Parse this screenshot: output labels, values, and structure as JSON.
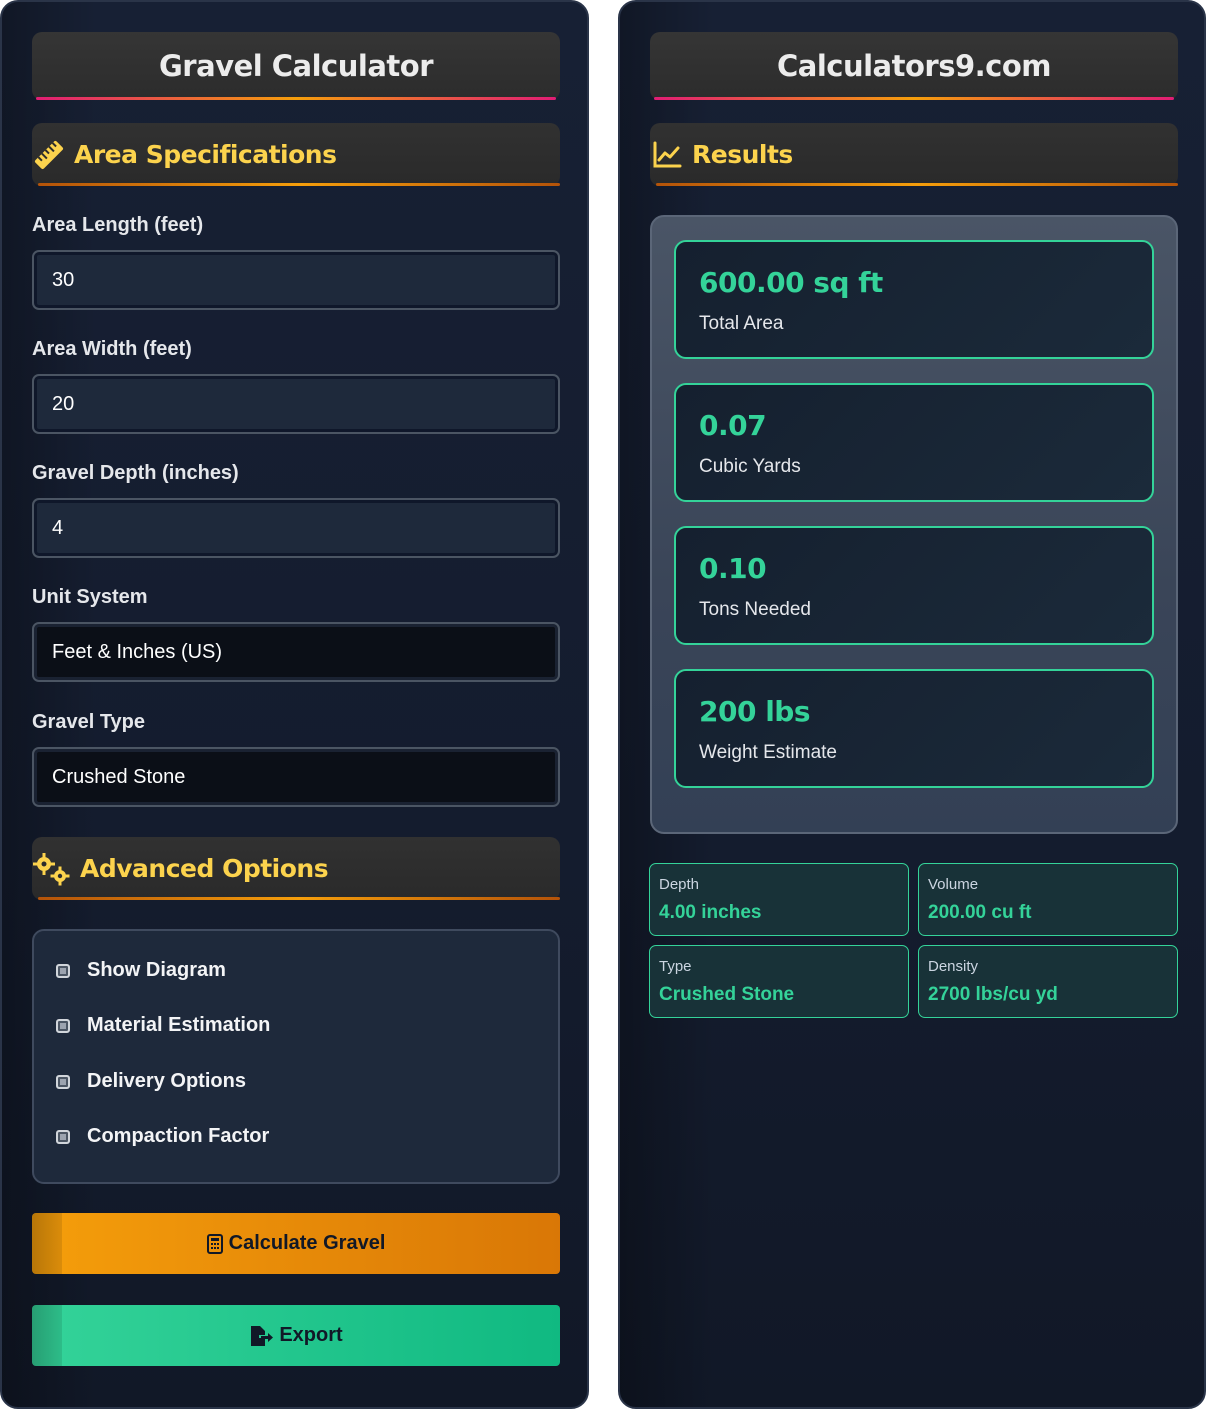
{
  "calculator": {
    "title": "Gravel Calculator",
    "area_section": "Area Specifications",
    "fields": [
      {
        "label": "Area Length (feet)",
        "value": "30"
      },
      {
        "label": "Area Width (feet)",
        "value": "20"
      },
      {
        "label": "Gravel Depth (inches)",
        "value": "4"
      }
    ],
    "unit_system": {
      "label": "Unit System",
      "value": "Feet & Inches (US)"
    },
    "gravel_type": {
      "label": "Gravel Type",
      "value": "Crushed Stone"
    },
    "advanced_section": "Advanced Options",
    "options": [
      {
        "label": "Show Diagram"
      },
      {
        "label": "Material Estimation"
      },
      {
        "label": "Delivery Options"
      },
      {
        "label": "Compaction Factor"
      }
    ],
    "calculate_label": "Calculate Gravel",
    "export_label": "Export"
  },
  "site": {
    "title": "Calculators9.com",
    "results_section": "Results",
    "results": [
      {
        "value": "600.00 sq ft",
        "label": "Total Area"
      },
      {
        "value": "0.07",
        "label": "Cubic Yards"
      },
      {
        "value": "0.10",
        "label": "Tons Needed"
      },
      {
        "value": "200 lbs",
        "label": "Weight Estimate"
      }
    ],
    "summary": [
      {
        "label": "Depth",
        "value": "4.00 inches"
      },
      {
        "label": "Volume",
        "value": "200.00 cu ft"
      },
      {
        "label": "Type",
        "value": "Crushed Stone"
      },
      {
        "label": "Density",
        "value": "2700 lbs/cu yd"
      }
    ]
  },
  "colors": {
    "accent_yellow": "#fcd34d",
    "accent_green": "#34d399",
    "accent_orange": "#f59e0b",
    "accent_pink": "#e11d74"
  }
}
